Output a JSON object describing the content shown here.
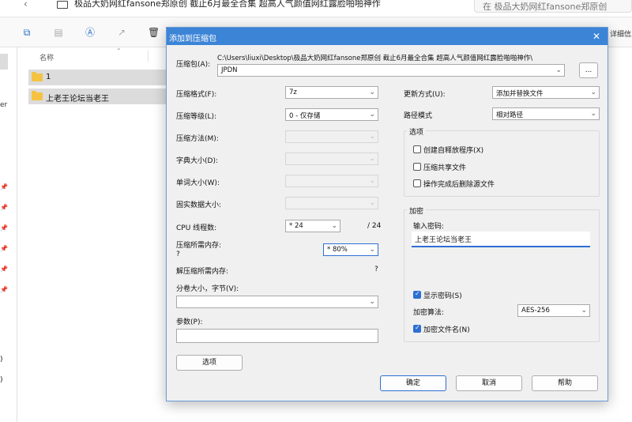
{
  "explorer": {
    "breadcrumb": "极品大奶网红fansone郑原创 截止6月最全合集 超高人气颜值网红露脸啪啪神作",
    "search_placeholder": "在 极品大奶网红fansone郑原创",
    "toolbar_more": "详细信息",
    "left_fragment": "er",
    "column_name": "名称",
    "files": [
      {
        "name": "1"
      },
      {
        "name": "上老王论坛当老王"
      }
    ],
    "left_bottom": [
      ")",
      ")"
    ]
  },
  "dialog": {
    "title": "添加到压缩包",
    "archive_label": "压缩包(A):",
    "archive_path": "C:\\Users\\liuxi\\Desktop\\极品大奶网红fansone郑原创 截止6月最全合集 超高人气颜值网红露脸啪啪神作\\",
    "archive_name": "JPDN",
    "browse_label": "...",
    "format_label": "压缩格式(F):",
    "format_value": "7z",
    "level_label": "压缩等级(L):",
    "level_value": "0 - 仅存储",
    "method_label": "压缩方法(M):",
    "dict_label": "字典大小(D):",
    "word_label": "单词大小(W):",
    "solid_label": "固实数据大小:",
    "cpu_label": "CPU 线程数:",
    "cpu_value": "* 24",
    "cpu_total": "/ 24",
    "mem_comp_label": "压缩所需内存:",
    "mem_comp_value": "?",
    "mem_comp_combo": "* 80%",
    "mem_decomp_label": "解压缩所需内存:",
    "mem_decomp_value": "?",
    "split_label": "分卷大小，字节(V):",
    "params_label": "参数(P):",
    "options_button": "选项",
    "update_label": "更新方式(U):",
    "update_value": "添加并替换文件",
    "pathmode_label": "路径模式",
    "pathmode_value": "相对路径",
    "options_group": "选项",
    "opt_sfx": "创建自释放程序(X)",
    "opt_shared": "压缩共享文件",
    "opt_delete": "操作完成后删除源文件",
    "encrypt_group": "加密",
    "password_label": "输入密码:",
    "password_value": "上老王论坛当老王",
    "show_password": "显示密码(S)",
    "enc_method_label": "加密算法:",
    "enc_method_value": "AES-256",
    "encrypt_names": "加密文件名(N)",
    "ok": "确定",
    "cancel": "取消",
    "help": "帮助"
  }
}
